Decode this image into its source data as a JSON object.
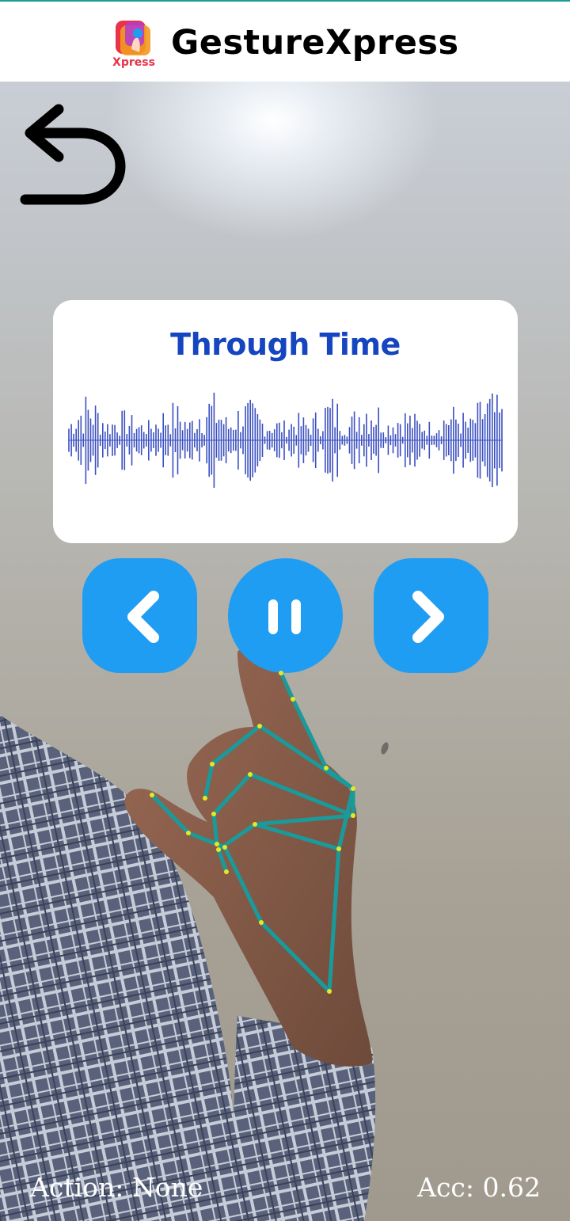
{
  "app": {
    "title": "GestureXpress",
    "logo_text": "Xpress",
    "accent_color": "#1f9df2",
    "logo_colors": [
      "#e8334a",
      "#f39a1d",
      "#b43ad0",
      "#1f9df2"
    ]
  },
  "navigation": {
    "back_icon": "undo-arrow-icon"
  },
  "player": {
    "track_title": "Through Time",
    "title_color": "#1546c0",
    "waveform_color": "#3a4fc0",
    "controls": {
      "previous_icon": "chevron-left-icon",
      "pause_icon": "pause-icon",
      "next_icon": "chevron-right-icon"
    }
  },
  "status": {
    "action_text": "Action: None",
    "accuracy_text": "Acc: 0.62"
  },
  "overlay": {
    "hand_landmark_color": "#1a9a9a",
    "landmark_point_color": "#e8e820"
  }
}
